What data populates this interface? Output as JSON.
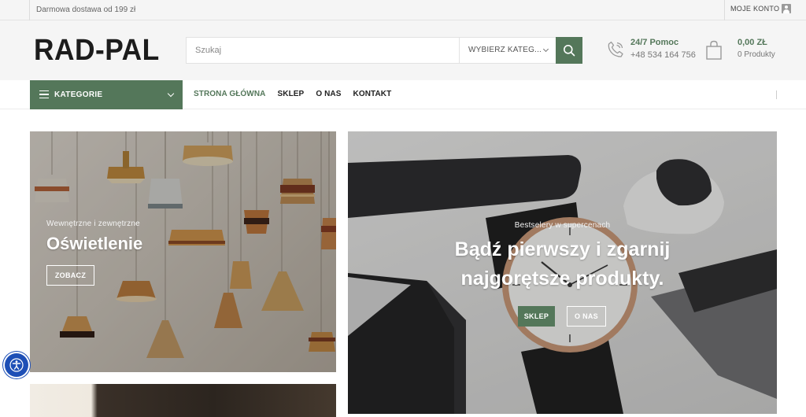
{
  "topbar": {
    "shipping": "Darmowa dostawa od 199 zł",
    "account": "MOJE KONTO"
  },
  "header": {
    "logo": "RAD-PAL",
    "search": {
      "placeholder": "Szukaj",
      "category": "WYBIERZ KATEG..."
    },
    "support": {
      "title": "24/7 Pomoc",
      "phone": "+48 534 164 756"
    },
    "cart": {
      "total": "0,00 ZŁ",
      "count": "0 Produkty"
    }
  },
  "nav": {
    "categories": "KATEGORIE",
    "links": [
      "STRONA GŁÓWNA",
      "SKLEP",
      "O NAS",
      "KONTAKT"
    ]
  },
  "banners": {
    "lighting": {
      "subtitle": "Wewnętrzne i zewnętrzne",
      "title": "Oświetlenie",
      "button": "ZOBACZ"
    },
    "promo": {
      "subtitle": "Bestselery w supercenach",
      "title_line1": "Bądź pierwszy i zgarnij",
      "title_line2": "najgorętsze produkty.",
      "button_shop": "SKLEP",
      "button_about": "O NAS"
    }
  },
  "colors": {
    "brand": "#54775a",
    "accessibility": "#1d4fb6"
  },
  "icons": [
    "user-icon",
    "search-icon",
    "phone-icon",
    "bag-icon",
    "menu-icon",
    "chevron-down-icon",
    "accessibility-icon"
  ]
}
